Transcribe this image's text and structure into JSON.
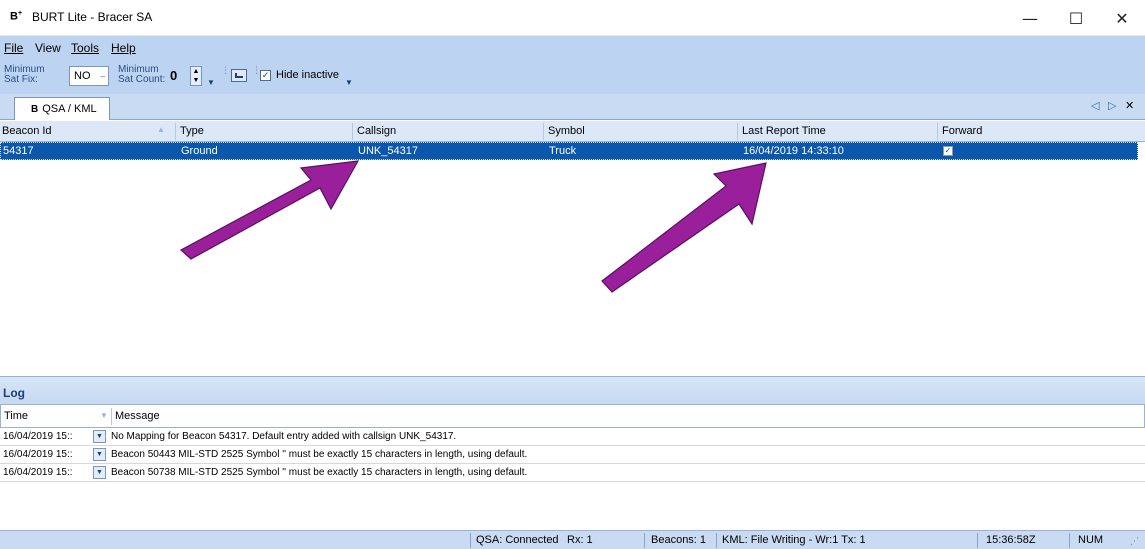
{
  "window": {
    "icon_text": "B",
    "title": "BURT Lite - Bracer SA",
    "minimize_glyph": "—",
    "maximize_glyph": "☐",
    "close_glyph": "✕"
  },
  "menu": {
    "items": [
      {
        "label": "File"
      },
      {
        "label": "View"
      },
      {
        "label": "Tools"
      },
      {
        "label": "Help"
      }
    ]
  },
  "toolbar": {
    "min_sat_fix_label_1": "Minimum",
    "min_sat_fix_label_2": "Sat Fix:",
    "min_sat_fix_value": "NO",
    "min_sat_count_label_1": "Minimum",
    "min_sat_count_label_2": "Sat Count:",
    "min_sat_count_value": "0",
    "hide_inactive_label": "Hide inactive",
    "hide_inactive_checked": true
  },
  "tabs": {
    "active": "QSA / KML",
    "icon_text": "B"
  },
  "grid": {
    "columns": [
      "Beacon Id",
      "Type",
      "Callsign",
      "Symbol",
      "Last Report Time",
      "Forward"
    ],
    "rows": [
      {
        "beacon_id": "54317",
        "type": "Ground",
        "callsign": "UNK_54317",
        "symbol": "Truck",
        "last_report_time": "16/04/2019 14:33:10",
        "forward": true
      }
    ]
  },
  "log": {
    "title": "Log",
    "columns": [
      "Time",
      "Message"
    ],
    "entries": [
      {
        "time": "16/04/2019 15::",
        "message": "No Mapping for Beacon 54317. Default entry added with callsign UNK_54317."
      },
      {
        "time": "16/04/2019 15::",
        "message": "Beacon 50443 MIL-STD 2525 Symbol '' must be exactly 15 characters in length, using default."
      },
      {
        "time": "16/04/2019 15::",
        "message": "Beacon 50738 MIL-STD 2525 Symbol '' must be exactly 15 characters in length, using default."
      }
    ]
  },
  "statusbar": {
    "qsa": "QSA: Connected",
    "rx": "Rx: 1",
    "beacons": "Beacons: 1",
    "kml": "KML: File Writing - Wr:1 Tx: 1",
    "time": "15:36:58Z",
    "num": "NUM"
  },
  "colors": {
    "selection": "#0b57ab",
    "chrome": "#bcd3f1",
    "arrow": "#9a1f9a"
  }
}
